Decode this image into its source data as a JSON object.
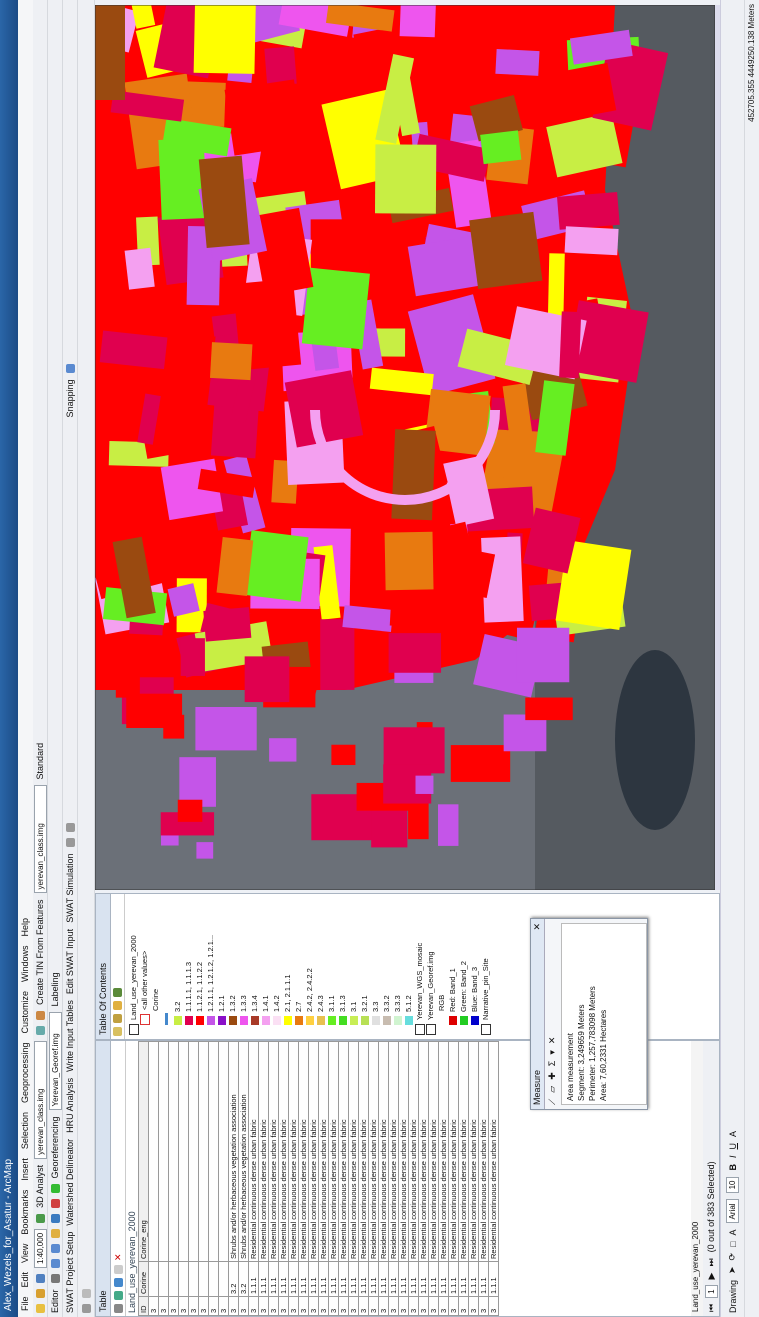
{
  "window": {
    "title": "Alex_Wezels_for_Asatur - ArcMap"
  },
  "menu": [
    "File",
    "Edit",
    "View",
    "Bookmarks",
    "Insert",
    "Selection",
    "Geoprocessing",
    "Customize",
    "Windows",
    "Help"
  ],
  "toolbars": {
    "scale": "1:40,000",
    "analyst": "3D Analyst",
    "layer1": "yerevan_class.img",
    "create_tin": "Create TIN From Features",
    "layer2": "yerevan_class.img",
    "editor": "Editor",
    "georef": "Georeferencing",
    "georef_layer": "Yerevan_Georef.img",
    "labeling": "Labeling",
    "standard": "Standard",
    "snapping": "Snapping",
    "swat": [
      "SWAT Project Setup",
      "Watershed Delineator",
      "HRU Analysis",
      "Write Input Tables",
      "Edit SWAT Input",
      "SWAT Simulation"
    ]
  },
  "table": {
    "title": "Table",
    "tab": "Land_use_yerevan_2000",
    "columns": [
      "ID",
      "Corine",
      "Corine_eng"
    ],
    "rows": [
      [
        "3",
        "",
        ""
      ],
      [
        "3",
        "",
        ""
      ],
      [
        "3",
        "",
        ""
      ],
      [
        "3",
        "",
        ""
      ],
      [
        "3",
        "",
        ""
      ],
      [
        "3",
        "",
        ""
      ],
      [
        "3",
        "",
        ""
      ],
      [
        "3",
        "",
        ""
      ],
      [
        "3",
        "3.2",
        "Shrubs and/or herbaceous vegetation association"
      ],
      [
        "3",
        "3.2",
        "Shrubs and/or herbaceous vegetation association"
      ],
      [
        "3",
        "1.1.1",
        "Residential continuous dense urban fabric"
      ],
      [
        "3",
        "1.1.1",
        "Residential continuous dense urban fabric"
      ],
      [
        "3",
        "1.1.1",
        "Residential continuous dense urban fabric"
      ],
      [
        "3",
        "1.1.1",
        "Residential continuous dense urban fabric"
      ],
      [
        "3",
        "1.1.1",
        "Residential continuous dense urban fabric"
      ],
      [
        "3",
        "1.1.1",
        "Residential continuous dense urban fabric"
      ],
      [
        "3",
        "1.1.1",
        "Residential continuous dense urban fabric"
      ],
      [
        "3",
        "1.1.1",
        "Residential continuous dense urban fabric"
      ],
      [
        "3",
        "1.1.1",
        "Residential continuous dense urban fabric"
      ],
      [
        "3",
        "1.1.1",
        "Residential continuous dense urban fabric"
      ],
      [
        "3",
        "1.1.1",
        "Residential continuous dense urban fabric"
      ],
      [
        "3",
        "1.1.1",
        "Residential continuous dense urban fabric"
      ],
      [
        "3",
        "1.1.1",
        "Residential continuous dense urban fabric"
      ],
      [
        "3",
        "1.1.1",
        "Residential continuous dense urban fabric"
      ],
      [
        "3",
        "1.1.1",
        "Residential continuous dense urban fabric"
      ],
      [
        "3",
        "1.1.1",
        "Residential continuous dense urban fabric"
      ],
      [
        "3",
        "1.1.1",
        "Residential continuous dense urban fabric"
      ],
      [
        "3",
        "1.1.1",
        "Residential continuous dense urban fabric"
      ],
      [
        "3",
        "1.1.1",
        "Residential continuous dense urban fabric"
      ],
      [
        "3",
        "1.1.1",
        "Residential continuous dense urban fabric"
      ],
      [
        "3",
        "1.1.1",
        "Residential continuous dense urban fabric"
      ],
      [
        "3",
        "1.1.1",
        "Residential continuous dense urban fabric"
      ],
      [
        "3",
        "1.1.1",
        "Residential continuous dense urban fabric"
      ],
      [
        "3",
        "1.1.1",
        "Residential continuous dense urban fabric"
      ],
      [
        "3",
        "1.1.1",
        "Residential continuous dense urban fabric"
      ]
    ],
    "record": "1",
    "selected": "(0 out of 383 Selected)"
  },
  "toc": {
    "title": "Table Of Contents",
    "layer": "Land_use_yerevan_2000",
    "other": "<all other values>",
    "field": "Corine",
    "classes": [
      {
        "label": "3.2",
        "color": "#c8ee44"
      },
      {
        "label": "1.1.1.1, 1.1.1.3",
        "color": "#e0004f"
      },
      {
        "label": "1.1.2.1, 1.1.2.2",
        "color": "#ff0000"
      },
      {
        "label": "1.2.1.1, 1.2.1.2, 1.2.1...",
        "color": "#c455e8"
      },
      {
        "label": "1.2.1",
        "color": "#8a10c8"
      },
      {
        "label": "1.3.2",
        "color": "#9a4a10"
      },
      {
        "label": "1.3.3",
        "color": "#ee55ee"
      },
      {
        "label": "1.3.4",
        "color": "#a83a28"
      },
      {
        "label": "1.4.1",
        "color": "#f4a0f0"
      },
      {
        "label": "1.4.2",
        "color": "#fbe0f4"
      },
      {
        "label": "2.1, 2.1.1.1",
        "color": "#ffff00"
      },
      {
        "label": "2.7",
        "color": "#e87a10"
      },
      {
        "label": "2.4.2, 2.4.2.2",
        "color": "#ffd040"
      },
      {
        "label": "2.4.3",
        "color": "#e8c050"
      },
      {
        "label": "3.1.1",
        "color": "#66ee22"
      },
      {
        "label": "3.1.3",
        "color": "#44dd22"
      },
      {
        "label": "3.1",
        "color": "#c8ee55"
      },
      {
        "label": "3.2.1",
        "color": "#b8e055"
      },
      {
        "label": "3.3",
        "color": "#e0e0e0"
      },
      {
        "label": "3.3.2",
        "color": "#c8bcb0"
      },
      {
        "label": "3.3.3",
        "color": "#d0f4d0"
      },
      {
        "label": "5.1.2",
        "color": "#66dddd"
      }
    ],
    "layers": [
      "Yerevan_WGS_mosaic",
      "Yerevan_Georef.img"
    ],
    "rgb": "RGB",
    "bands": [
      "Red: Band_1",
      "Green: Band_2",
      "Blue: Band_3"
    ],
    "last_layer": "Narrative_pin_Site"
  },
  "measure": {
    "title": "Measure",
    "lines": [
      "Area measurement",
      "Segment: 3,249659 Meters",
      "Perimeter: 1,257,783098 Meters",
      "Area: 7,60,2331 Hectares"
    ]
  },
  "drawing": {
    "label": "Drawing",
    "font": "Arial",
    "size": "10"
  },
  "status": {
    "coords": "452705.355  4449250.138 Meters"
  }
}
